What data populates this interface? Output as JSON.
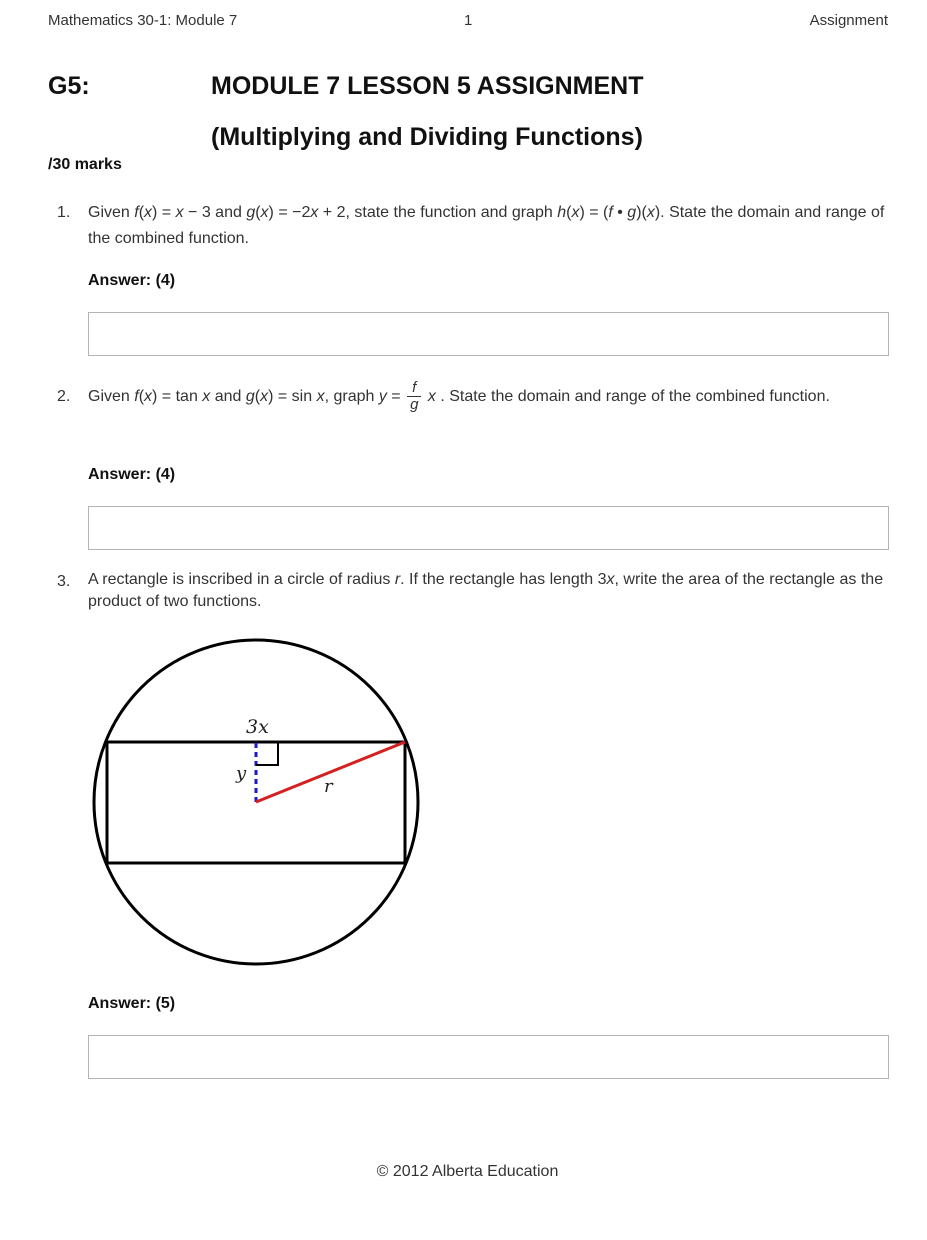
{
  "header": {
    "left": "Mathematics 30-1: Module 7",
    "page_number": "1",
    "right": "Assignment"
  },
  "doc": {
    "code": "G5:",
    "title": "MODULE 7 LESSON 5 ASSIGNMENT",
    "subtitle": "(Multiplying and Dividing Functions)",
    "total_marks": "/30 marks"
  },
  "questions": [
    {
      "number": "1.",
      "text_parts": {
        "a": "Given ",
        "f": "f",
        "b": "(",
        "x1": "x",
        "c": ") = ",
        "x2": "x",
        "d": " − 3 and ",
        "g": "g",
        "e": "(",
        "x3": "x",
        "f2": ") = −2",
        "x4": "x",
        "g2": " + 2, state the function and graph ",
        "h": "h",
        "h2": "(",
        "x5": "x",
        "i": ") = (",
        "f3": "f",
        "j": " • ",
        "g3": "g",
        "k": ")(",
        "x6": "x",
        "l": "). State the domain and range of the combined function."
      },
      "answer_label": "Answer: (4)",
      "answer_value": ""
    },
    {
      "number": "2.",
      "text_parts": {
        "a": "Given ",
        "f": "f",
        "b": "(",
        "x1": "x",
        "c": ") = tan ",
        "x2": "x",
        "d": " and ",
        "g": "g",
        "e": "(",
        "x3": "x",
        "f2": ") = sin ",
        "x4": "x",
        "g2": ", graph ",
        "y": "y",
        "eq": " = ",
        "frac_num": "f",
        "frac_den": "g",
        "x5": "x",
        "h": " . State the domain and range of the combined function."
      },
      "answer_label": "Answer: (4)",
      "answer_value": ""
    },
    {
      "number": "3.",
      "text_parts": {
        "a": "A rectangle is inscribed in a circle of radius ",
        "r": "r",
        "b": ". If the rectangle has length 3",
        "x": "x",
        "c": ", write the area of the rectangle as the product of two functions."
      },
      "diagram": {
        "label_length": "3x",
        "label_height": "y",
        "label_radius": "r",
        "colors": {
          "radius": "#d42020",
          "height": "#1a1ad0",
          "outline": "#000000"
        }
      },
      "answer_label": "Answer: (5)",
      "answer_value": ""
    }
  ],
  "footer": {
    "copyright": "© 2012 Alberta Education"
  }
}
